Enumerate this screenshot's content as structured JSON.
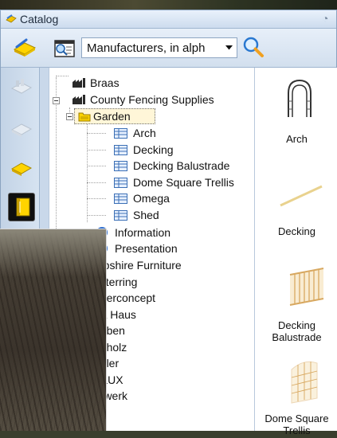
{
  "window": {
    "title": "Catalog"
  },
  "toolbar": {
    "select_value": "Manufacturers, in alph"
  },
  "tree": {
    "items": [
      {
        "label": "Braas",
        "icon": "manufacturer-icon"
      },
      {
        "label": "County Fencing Supplies",
        "icon": "manufacturer-icon",
        "expanded": true
      },
      {
        "label": "Garden",
        "icon": "folder-icon",
        "expanded": true
      },
      {
        "label": "Arch",
        "icon": "table-icon"
      },
      {
        "label": "Decking",
        "icon": "table-icon"
      },
      {
        "label": "Decking Balustrade",
        "icon": "table-icon"
      },
      {
        "label": "Dome Square Trellis",
        "icon": "table-icon"
      },
      {
        "label": "Omega",
        "icon": "table-icon"
      },
      {
        "label": "Shed",
        "icon": "table-icon"
      },
      {
        "label": "Information",
        "icon": "info-icon"
      },
      {
        "label": "Presentation",
        "icon": "presentation-icon"
      },
      {
        "label": "mpshire Furniture"
      },
      {
        "label": "usterring"
      },
      {
        "label": "eperconcept"
      },
      {
        "label": "rta Haus"
      },
      {
        "label": "beben"
      },
      {
        "label": "anholz"
      },
      {
        "label": "euler"
      },
      {
        "label": "ELUX"
      },
      {
        "label": "orwerk"
      }
    ]
  },
  "preview": {
    "items": [
      {
        "label": "Arch"
      },
      {
        "label": "Decking"
      },
      {
        "label": "Decking Balustrade"
      },
      {
        "label": "Dome Square Trellis"
      }
    ]
  },
  "colors": {
    "accent": "#ffd400",
    "window_bg": "#c9d8ea"
  }
}
